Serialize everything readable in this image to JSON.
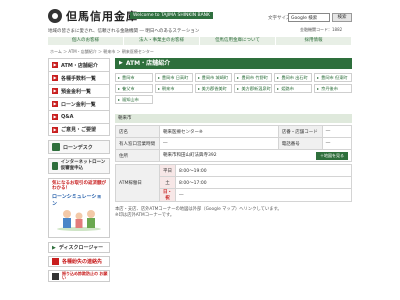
{
  "header": {
    "logo_text": "但馬信用金庫",
    "logo_en": "Welcome to TAJIMA SHINKIN BANK",
    "tagline": "地域の皆さまに愛され、信頼される金融機関 ― 明日へのあるステーション",
    "font_size_label": "文字サイズ",
    "search_value": "Google 検索",
    "search_button": "検索",
    "store_code": "金融機関コード：1882"
  },
  "nav": {
    "items": [
      {
        "label": "個人のお客様"
      },
      {
        "label": "法人・事業主のお客様"
      },
      {
        "label": "但馬信用金庫について"
      },
      {
        "label": "採用情報"
      }
    ]
  },
  "breadcrumb": "ホーム ＞ ATM・店舗紹介 ＞ 朝来市 ＞ 朝来医療センター",
  "sidebar": {
    "items": [
      {
        "label": "ATM・店舗紹介"
      },
      {
        "label": "各種手数料一覧"
      },
      {
        "label": "預金金利一覧"
      },
      {
        "label": "ローン金利一覧"
      },
      {
        "label": "Q&A"
      },
      {
        "label": "ご意見・ご要望"
      }
    ],
    "loan_desk": "ローンデスク",
    "internet_banking": "インターネットローン 仮審査申込",
    "promo_title": "気になるお取引の返済額がわかる！",
    "promo_sub": "ローンシミュレーション",
    "disclosure": "ディスクロージャー",
    "alert": "各種紛失の連絡先",
    "warn": "振り込め詐欺防止の お願い"
  },
  "main": {
    "title": "ATM・店舗紹介",
    "areas": [
      "豊岡市",
      "豊岡市 日高町",
      "豊岡市 城崎町",
      "豊岡市 竹野町",
      "豊岡市 出石町",
      "豊岡市 但東町",
      "養父市",
      "朝来市",
      "美方郡香美町",
      "美方郡新温泉町",
      "姫路市",
      "京丹後市",
      "福知山市"
    ],
    "section_label": "朝来市",
    "store_name_label": "店名",
    "store_name": "朝来医療センター",
    "store_name_suffix": "※",
    "store_code_label": "店番・店舗コード",
    "store_code_value": "―",
    "staff_label": "有人窓口営業時間",
    "staff_value": "―",
    "phone_label": "電話番号",
    "phone_value": "―",
    "address_label": "住所",
    "address_value": "朝来市和田山町法興寺392",
    "map_button": "＋地図を見る",
    "atm_label": "ATM稼働日",
    "hours": [
      {
        "day": "平日",
        "time": "8:00〜19:00",
        "red": false
      },
      {
        "day": "土",
        "time": "8:00〜17:00",
        "red": false
      },
      {
        "day": "日・祝",
        "time": "―",
        "red": true
      }
    ],
    "note1": "本店・支店、店外ATMコーナーの地図は外部（Google マップ）へリンクしています。",
    "note2": "※印は店外ATMコーナーです。"
  }
}
